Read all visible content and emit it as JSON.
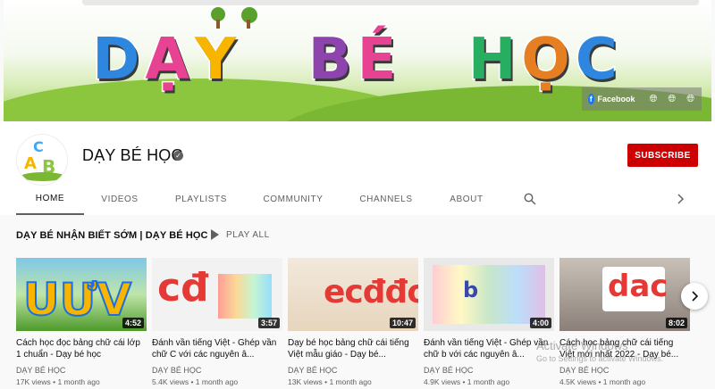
{
  "banner": {
    "title_parts": [
      "D",
      "Ạ",
      "Y",
      "B",
      "É",
      "H",
      "Ọ",
      "C"
    ],
    "title_colors": [
      "#2e86de",
      "#e84393",
      "#f7b500",
      "#8e44ad",
      "#e84393",
      "#27ae60",
      "#e67e22",
      "#2e86de"
    ],
    "social": {
      "facebook_label": "Facebook"
    }
  },
  "channel": {
    "name": "DẠY BÉ HỌC",
    "subscribe_label": "SUBSCRIBE",
    "avatar_letters": [
      "C",
      "A",
      "B"
    ]
  },
  "tabs": [
    {
      "label": "HOME",
      "active": true
    },
    {
      "label": "VIDEOS"
    },
    {
      "label": "PLAYLISTS"
    },
    {
      "label": "COMMUNITY"
    },
    {
      "label": "CHANNELS"
    },
    {
      "label": "ABOUT"
    }
  ],
  "section": {
    "title": "DẠY BÉ NHẬN BIẾT SỚM | DẠY BÉ HỌC",
    "play_all_label": "PLAY ALL"
  },
  "videos": [
    {
      "title": "Cách học đọc bảng chữ cái lớp 1 chuẩn - Dạy bé học",
      "channel": "DẠY BÉ HỌC",
      "meta": "17K views • 1 month ago",
      "duration": "4:52",
      "thumb_text": "UƯV"
    },
    {
      "title": "Đánh vần tiếng Việt - Ghép vần chữ C với các nguyên â...",
      "channel": "DẠY BÉ HỌC",
      "meta": "5.4K views • 1 month ago",
      "duration": "3:57",
      "thumb_text": "cđ"
    },
    {
      "title": "Dạy bé học bảng chữ cái tiếng Việt mẫu giáo - Dạy bé...",
      "channel": "DẠY BÉ HỌC",
      "meta": "13K views • 1 month ago",
      "duration": "10:47",
      "thumb_text": "ecđđơ"
    },
    {
      "title": "Đánh vần tiếng Việt - Ghép vần chữ b với các nguyên â...",
      "channel": "DẠY BÉ HỌC",
      "meta": "4.9K views • 1 month ago",
      "duration": "4:00",
      "thumb_text": "b"
    },
    {
      "title": "Cách học bảng chữ cái tiếng Việt mới nhất 2022 - Dạy bé...",
      "channel": "DẠY BÉ HỌC",
      "meta": "4.5K views • 1 month ago",
      "duration": "8:02",
      "thumb_text": "dac"
    }
  ],
  "watermark": {
    "line1": "Activate Windows",
    "line2": "Go to Settings to activate Windows."
  },
  "icons": {
    "verified": "verified-check-icon",
    "search": "search-icon",
    "next": "chevron-right-icon",
    "play": "play-icon",
    "globe": "globe-icon",
    "facebook": "facebook-icon"
  },
  "colors": {
    "subscribe": "#cc0000",
    "text_primary": "#0f0f0f",
    "text_secondary": "#606060"
  }
}
